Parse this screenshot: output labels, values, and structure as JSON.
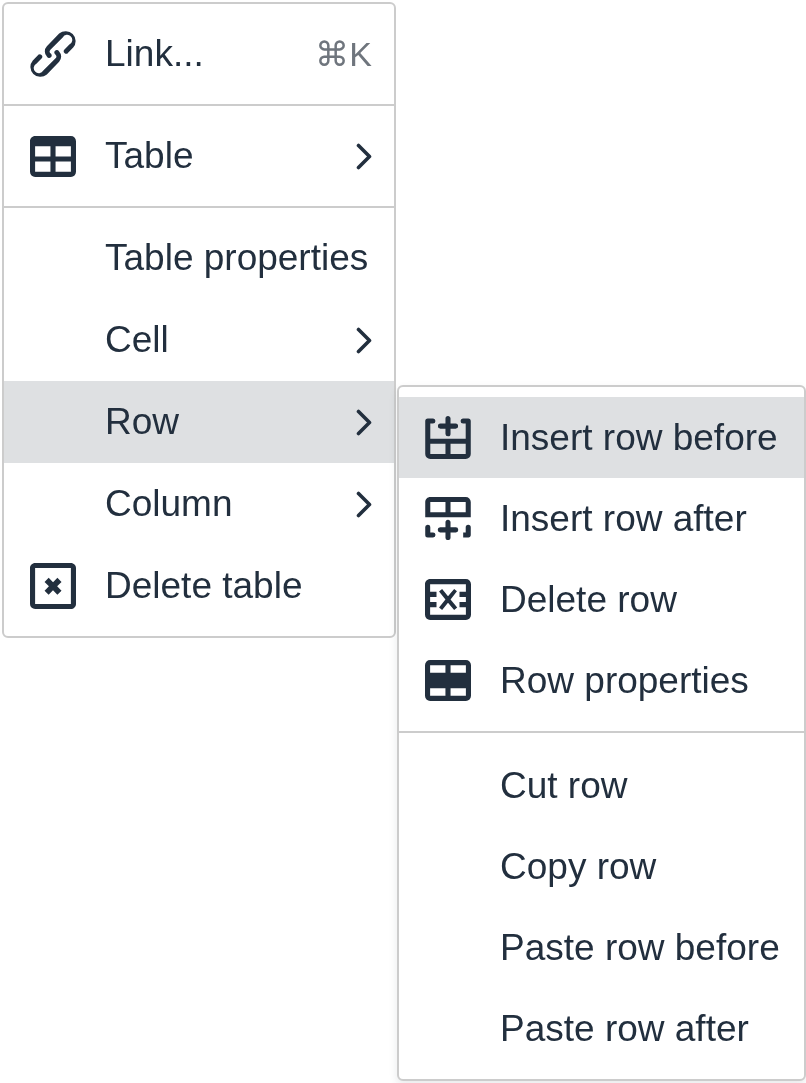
{
  "menu": {
    "groups": [
      {
        "items": [
          {
            "label": "Link...",
            "shortcut": "⌘K",
            "has_submenu": false,
            "selected": false
          }
        ]
      },
      {
        "items": [
          {
            "label": "Table",
            "has_submenu": true,
            "selected": false
          }
        ]
      },
      {
        "items": [
          {
            "label": "Table properties",
            "has_submenu": false,
            "selected": false
          },
          {
            "label": "Cell",
            "has_submenu": true,
            "selected": false
          },
          {
            "label": "Row",
            "has_submenu": true,
            "selected": true
          },
          {
            "label": "Column",
            "has_submenu": true,
            "selected": false
          },
          {
            "label": "Delete table",
            "has_submenu": false,
            "selected": false
          }
        ]
      }
    ]
  },
  "submenu": {
    "groups": [
      {
        "items": [
          {
            "label": "Insert row before",
            "selected": true
          },
          {
            "label": "Insert row after",
            "selected": false
          },
          {
            "label": "Delete row",
            "selected": false
          },
          {
            "label": "Row properties",
            "selected": false
          }
        ]
      },
      {
        "items": [
          {
            "label": "Cut row",
            "selected": false
          },
          {
            "label": "Copy row",
            "selected": false
          },
          {
            "label": "Paste row before",
            "selected": false
          },
          {
            "label": "Paste row after",
            "selected": false
          }
        ]
      }
    ]
  }
}
